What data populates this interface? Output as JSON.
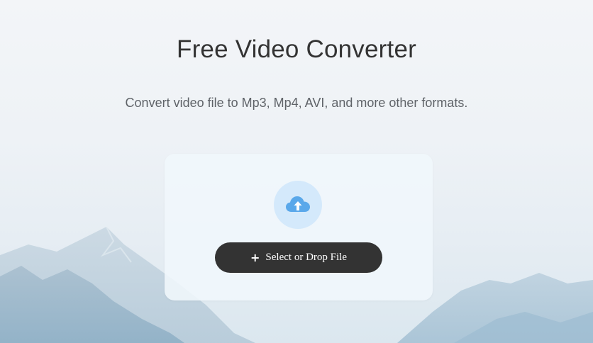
{
  "page": {
    "title": "Free Video Converter",
    "subtitle": "Convert video file to Mp3, Mp4, AVI, and more other formats."
  },
  "upload": {
    "icon": "cloud-upload-icon",
    "button_icon": "plus-icon",
    "button_label": "Select or Drop File"
  },
  "colors": {
    "button_bg": "#333333",
    "icon_circle": "#d4e9fb",
    "cloud": "#5aa8ea"
  }
}
